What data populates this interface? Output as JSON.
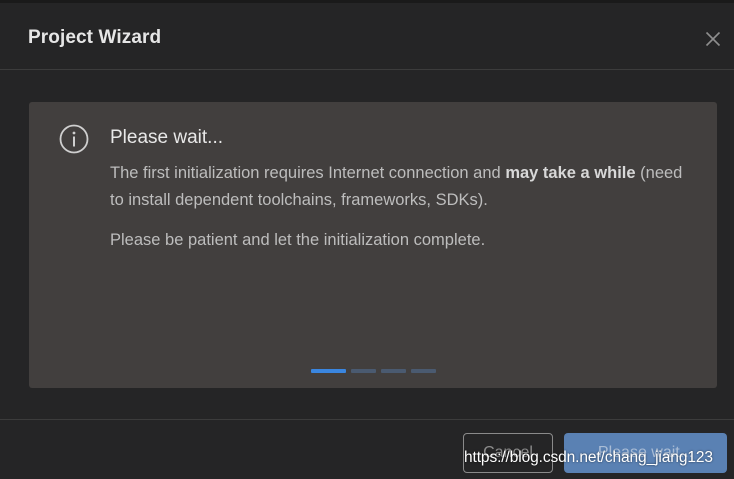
{
  "dialog": {
    "title": "Project Wizard",
    "close_icon": "close-icon"
  },
  "panel": {
    "icon": "info-icon",
    "heading": "Please wait...",
    "line1_prefix": "The first initialization requires Internet connection and ",
    "line1_bold": "may take a while",
    "line1_suffix": " (need to install dependent toolchains, frameworks, SDKs).",
    "line2": "Please be patient and let the initialization complete.",
    "progress": {
      "segments": 4,
      "active_index": 0
    }
  },
  "footer": {
    "cancel_label": "Cancel",
    "primary_label": "Please wait..."
  },
  "watermark": {
    "text": "https://blog.csdn.net/chang_jiang123"
  },
  "colors": {
    "accent": "#3a86e0",
    "primary_button": "#5a81b3",
    "panel_bg": "#423f3e",
    "dialog_bg": "#252526"
  }
}
